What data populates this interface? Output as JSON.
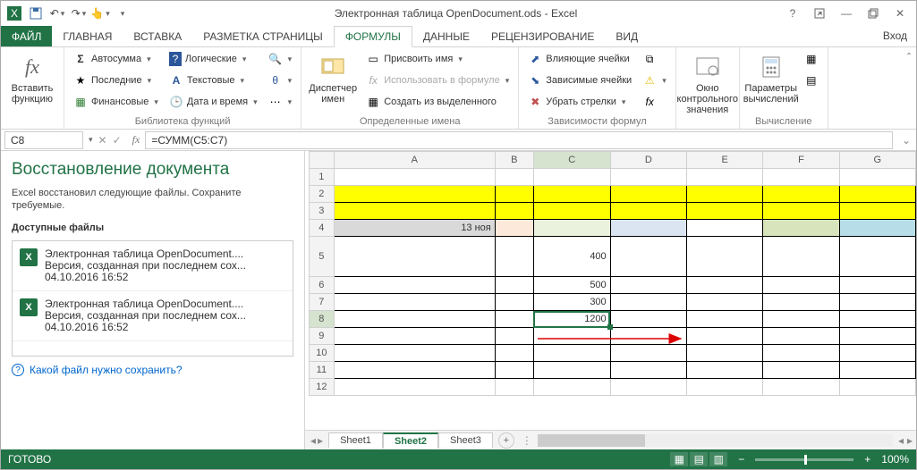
{
  "titlebar": {
    "qat_icons": [
      "excel-logo",
      "save",
      "undo",
      "redo",
      "touch-mode",
      "customize"
    ],
    "title": "Электронная таблица OpenDocument.ods - Excel",
    "help_icon": "help",
    "window_icons": [
      "ribbon-options",
      "minimize",
      "restore",
      "close"
    ]
  },
  "tabs": {
    "file": "ФАЙЛ",
    "items": [
      "ГЛАВНАЯ",
      "ВСТАВКА",
      "РАЗМЕТКА СТРАНИЦЫ",
      "ФОРМУЛЫ",
      "ДАННЫЕ",
      "РЕЦЕНЗИРОВАНИЕ",
      "ВИД"
    ],
    "active_index": 3,
    "login": "Вход"
  },
  "ribbon": {
    "group0": {
      "insert_fn": "Вставить функцию",
      "caption": ""
    },
    "group1": {
      "autosum": "Автосумма",
      "recent": "Последние",
      "financial": "Финансовые",
      "logical": "Логические",
      "text": "Текстовые",
      "datetime": "Дата и время",
      "caption": "Библиотека функций"
    },
    "group2": {
      "name_mgr": "Диспетчер имен",
      "define": "Присвоить имя",
      "use": "Использовать в формуле",
      "create": "Создать из выделенного",
      "caption": "Определенные имена"
    },
    "group3": {
      "prec": "Влияющие ячейки",
      "dep": "Зависимые ячейки",
      "remove": "Убрать стрелки",
      "caption": "Зависимости формул"
    },
    "group4": {
      "watch": "Окно контрольного значения",
      "caption": ""
    },
    "group5": {
      "calc_opts": "Параметры вычислений",
      "caption": "Вычисление"
    }
  },
  "formula_bar": {
    "name_box": "C8",
    "formula": "=СУММ(C5:C7)"
  },
  "recovery": {
    "title": "Восстановление документа",
    "desc": "Excel восстановил следующие файлы. Сохраните требуемые.",
    "avail": "Доступные файлы",
    "items": [
      {
        "name": "Электронная таблица OpenDocument....",
        "ver": "Версия, созданная при последнем сох...",
        "ts": "04.10.2016 16:52"
      },
      {
        "name": "Электронная таблица OpenDocument....",
        "ver": "Версия, созданная при последнем сох...",
        "ts": "04.10.2016 16:52"
      }
    ],
    "link": "Какой файл нужно сохранить?"
  },
  "sheet": {
    "columns": [
      "A",
      "B",
      "C",
      "D",
      "E",
      "F",
      "G"
    ],
    "rows": [
      1,
      2,
      3,
      4,
      5,
      6,
      7,
      8,
      9,
      10,
      11,
      12
    ],
    "cells": {
      "A4": "13 ноя",
      "C5": "400",
      "C6": "500",
      "C7": "300",
      "C8": "1200"
    },
    "active_cell": "C8",
    "tabs": [
      "Sheet1",
      "Sheet2",
      "Sheet3"
    ],
    "active_tab": 1
  },
  "status": {
    "ready": "ГОТОВО",
    "zoom": "100%"
  }
}
